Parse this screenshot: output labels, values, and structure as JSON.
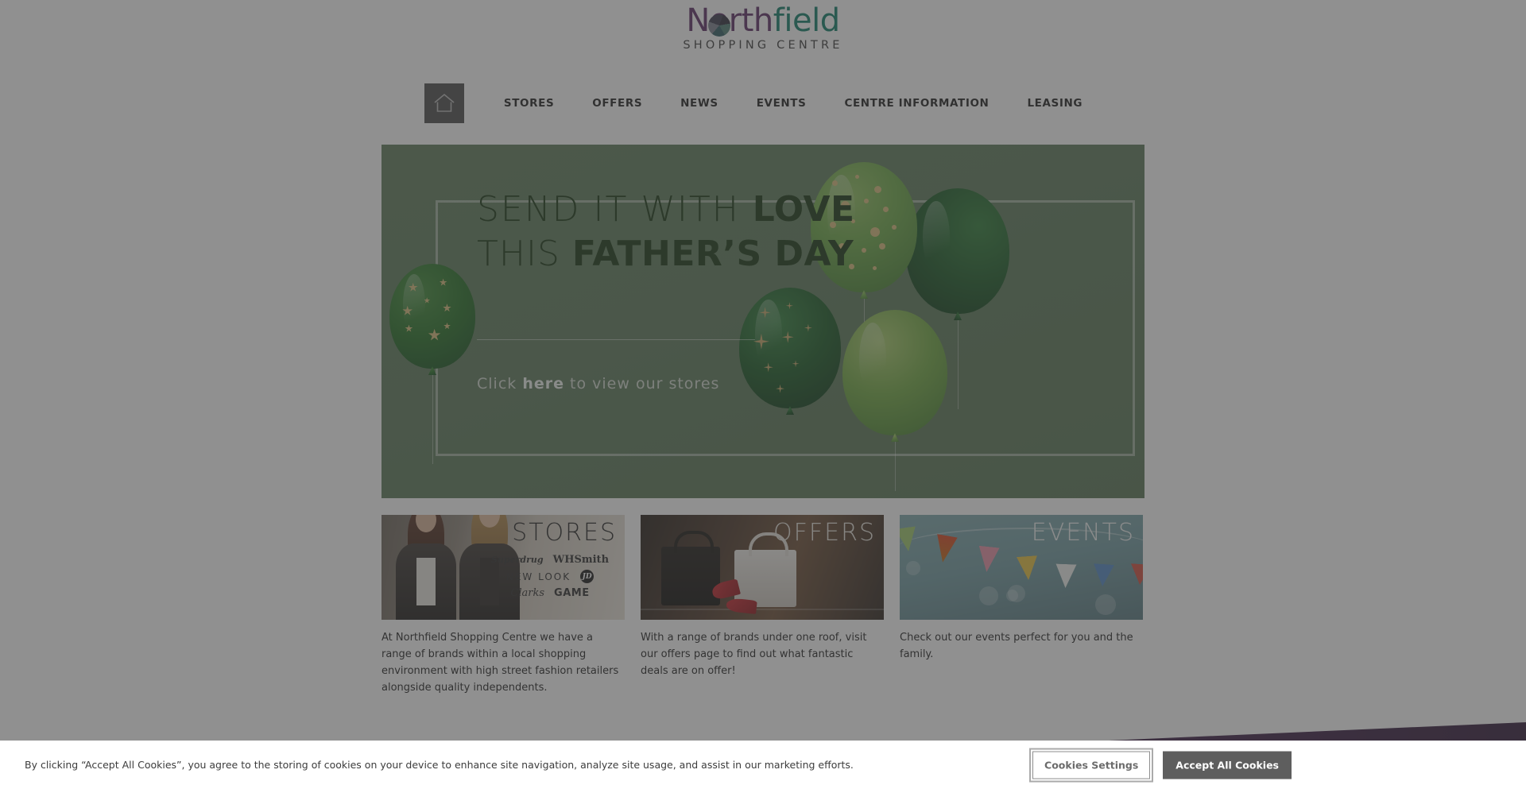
{
  "brand": {
    "name_part1": "North",
    "name_part2": "field",
    "tagline": "SHOPPING CENTRE",
    "color_purple": "#5c2d64",
    "color_teal": "#0e7c66"
  },
  "nav": {
    "home_icon": "home-icon",
    "items": [
      {
        "label": "STORES"
      },
      {
        "label": "OFFERS"
      },
      {
        "label": "NEWS"
      },
      {
        "label": "EVENTS"
      },
      {
        "label": "CENTRE INFORMATION"
      },
      {
        "label": "LEASING"
      }
    ]
  },
  "hero": {
    "line1_light": "SEND IT WITH ",
    "line1_bold": "LOVE",
    "line2_light": "THIS ",
    "line2_bold": "FATHER’S DAY",
    "cta_pre": "Click ",
    "cta_link": "here",
    "cta_post": " to view our stores",
    "background_color": "#5b7858",
    "text_color": "#14340f"
  },
  "cards": [
    {
      "title": "STORES",
      "title_color": "#1f1f1f",
      "description": "At Northfield Shopping Centre we have a range of brands within a local shopping environment with high street fashion retailers alongside quality independents.",
      "brands": [
        "Superdrug",
        "WHSmith",
        "NEW LOOK",
        "JD",
        "Clarks",
        "GAME"
      ]
    },
    {
      "title": "OFFERS",
      "title_color": "#e8e4de",
      "description": "With a range of brands under one roof, visit our offers page to find out what fantastic deals are on offer!"
    },
    {
      "title": "EVENTS",
      "title_color": "#f0f4f4",
      "description": "Check out our events perfect for you and the family."
    }
  ],
  "cookie_banner": {
    "message": "By clicking “Accept All Cookies”, you agree to the storing of cookies on your device to enhance site navigation, analyze site usage, and assist in our marketing efforts.",
    "settings_label": "Cookies Settings",
    "accept_label": "Accept All Cookies",
    "accept_bg": "#5e5e5e"
  },
  "footer": {
    "wedge_color": "#3a1d44"
  }
}
